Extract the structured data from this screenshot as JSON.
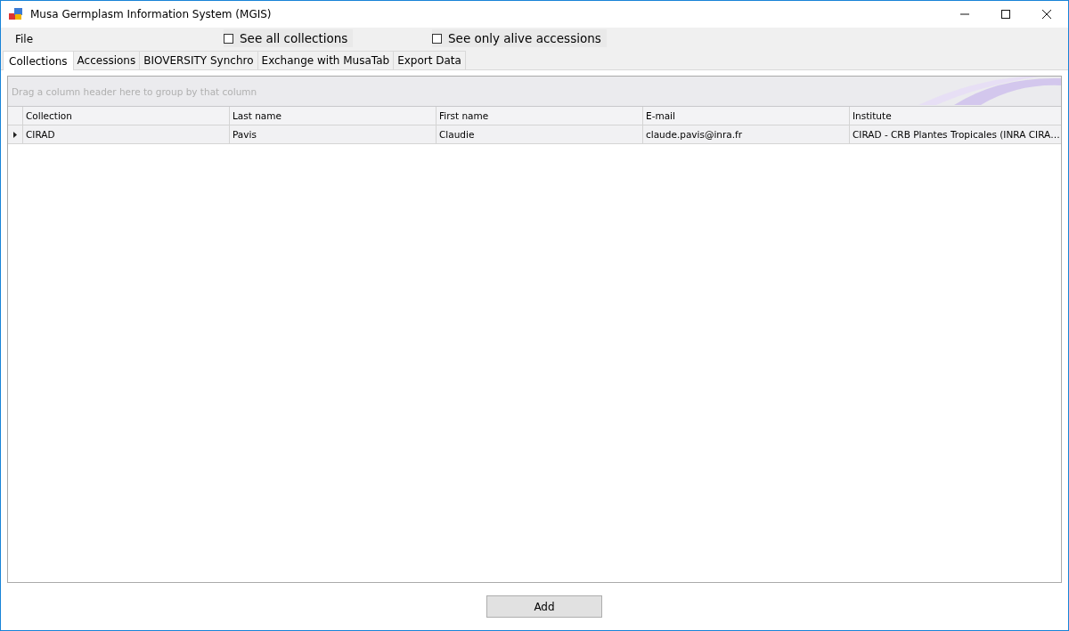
{
  "window": {
    "title": "Musa Germplasm Information System (MGIS)"
  },
  "menu": {
    "items": [
      "File"
    ]
  },
  "options": [
    {
      "label": "See all collections",
      "checked": false
    },
    {
      "label": "See only alive accessions",
      "checked": false
    }
  ],
  "tabs": [
    {
      "label": "Collections",
      "selected": true
    },
    {
      "label": "Accessions",
      "selected": false
    },
    {
      "label": "BIOVERSITY Synchro",
      "selected": false
    },
    {
      "label": "Exchange with MusaTab",
      "selected": false
    },
    {
      "label": "Export Data",
      "selected": false
    }
  ],
  "grid": {
    "group_panel_hint": "Drag a column header here to group by that column",
    "columns": [
      "Collection",
      "Last name",
      "First name",
      "E-mail",
      "Institute"
    ],
    "rows": [
      {
        "selected": true,
        "cells": [
          "CIRAD",
          "Pavis",
          "Claudie",
          "claude.pavis@inra.fr",
          "CIRAD - CRB Plantes Tropicales (INRA CIRA…"
        ]
      }
    ]
  },
  "buttons": [
    "Add"
  ]
}
